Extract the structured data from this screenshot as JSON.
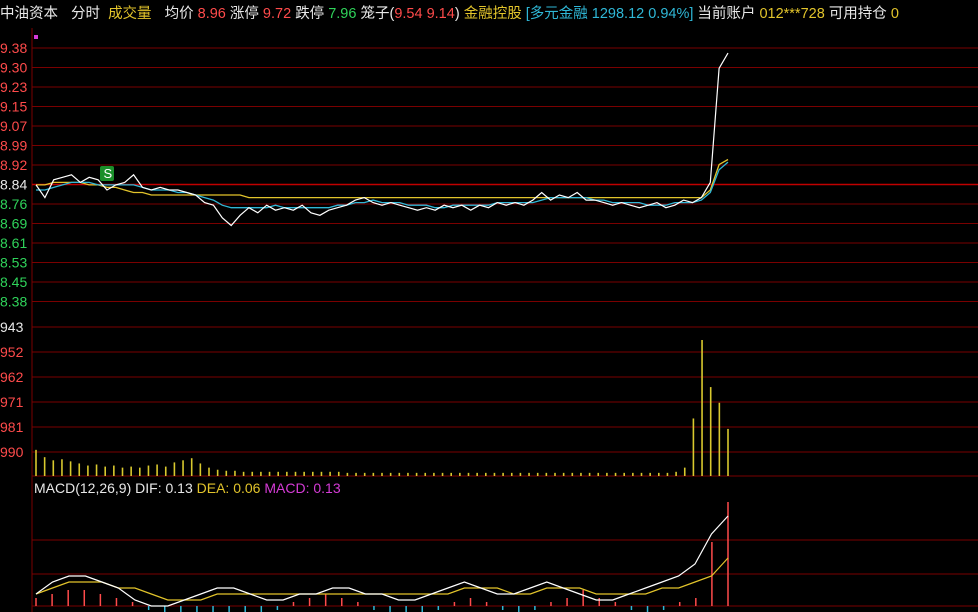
{
  "header": {
    "stock_name": "中油资本",
    "mode": "分时",
    "indicator": "成交量",
    "avg_label": "均价",
    "avg_value": "8.96",
    "limit_up_label": "涨停",
    "limit_up_value": "9.72",
    "limit_down_label": "跌停",
    "limit_down_value": "7.96",
    "cage_label": "笼子(",
    "cage_high": "9.54",
    "cage_low": "9.14",
    "cage_close": ")",
    "sector": "金融控股",
    "index_text": "[多元金融 1298.12 0.94%]",
    "account_label": "当前账户",
    "account_value": "012***728",
    "holding_label": "可用持仓",
    "holding_value": "0"
  },
  "price_axis": {
    "labels": [
      "9.38",
      "9.30",
      "9.23",
      "9.15",
      "9.07",
      "8.99",
      "8.92",
      "8.84",
      "8.76",
      "8.69",
      "8.61",
      "8.53",
      "8.45",
      "8.38"
    ],
    "prev_close": "8.84"
  },
  "volume_axis": {
    "labels": [
      "943",
      "952",
      "962",
      "971",
      "981",
      "990"
    ]
  },
  "trade_marker": "S",
  "macd": {
    "title": "MACD(12,26,9)",
    "dif_label": "DIF: 0.13",
    "dea_label": "DEA: 0.06",
    "macd_label": "MACD: 0.13"
  },
  "colors": {
    "price_line": "#ffffff",
    "avg_line": "#e2c42b",
    "ma_line": "#2fb7d6",
    "grid": "#7a0000",
    "up": "#ff4b4b",
    "down": "#2fd35a",
    "marker_bg": "#1a8f2a"
  },
  "chart_data": {
    "type": "line",
    "title": "",
    "ylim": [
      8.38,
      9.38
    ],
    "prev_close": 8.84,
    "price": [
      8.84,
      8.79,
      8.86,
      8.87,
      8.88,
      8.85,
      8.87,
      8.86,
      8.82,
      8.84,
      8.85,
      8.88,
      8.83,
      8.82,
      8.83,
      8.82,
      8.82,
      8.81,
      8.8,
      8.77,
      8.76,
      8.71,
      8.68,
      8.72,
      8.75,
      8.73,
      8.76,
      8.74,
      8.75,
      8.74,
      8.76,
      8.73,
      8.72,
      8.74,
      8.75,
      8.76,
      8.78,
      8.79,
      8.77,
      8.76,
      8.77,
      8.76,
      8.75,
      8.74,
      8.75,
      8.74,
      8.76,
      8.75,
      8.76,
      8.74,
      8.76,
      8.75,
      8.77,
      8.76,
      8.77,
      8.76,
      8.78,
      8.81,
      8.78,
      8.8,
      8.79,
      8.81,
      8.78,
      8.78,
      8.77,
      8.76,
      8.77,
      8.76,
      8.75,
      8.76,
      8.77,
      8.75,
      8.76,
      8.78,
      8.77,
      8.79,
      8.85,
      9.3,
      9.36
    ],
    "avg": [
      8.84,
      8.84,
      8.85,
      8.85,
      8.85,
      8.85,
      8.84,
      8.84,
      8.83,
      8.83,
      8.82,
      8.81,
      8.81,
      8.8,
      8.8,
      8.8,
      8.8,
      8.8,
      8.8,
      8.8,
      8.8,
      8.8,
      8.8,
      8.8,
      8.79,
      8.79,
      8.79,
      8.79,
      8.79,
      8.79,
      8.79,
      8.79,
      8.79,
      8.79,
      8.79,
      8.79,
      8.79,
      8.79,
      8.79,
      8.79,
      8.79,
      8.79,
      8.79,
      8.79,
      8.79,
      8.79,
      8.79,
      8.79,
      8.79,
      8.79,
      8.79,
      8.79,
      8.79,
      8.79,
      8.79,
      8.79,
      8.79,
      8.79,
      8.79,
      8.79,
      8.79,
      8.79,
      8.79,
      8.79,
      8.79,
      8.79,
      8.79,
      8.79,
      8.79,
      8.79,
      8.79,
      8.79,
      8.79,
      8.79,
      8.79,
      8.79,
      8.82,
      8.92,
      8.94
    ],
    "ma": [
      8.82,
      8.82,
      8.83,
      8.84,
      8.85,
      8.85,
      8.85,
      8.84,
      8.84,
      8.84,
      8.84,
      8.84,
      8.83,
      8.82,
      8.82,
      8.82,
      8.81,
      8.81,
      8.8,
      8.79,
      8.78,
      8.76,
      8.75,
      8.75,
      8.75,
      8.75,
      8.75,
      8.76,
      8.75,
      8.75,
      8.75,
      8.75,
      8.75,
      8.75,
      8.76,
      8.76,
      8.77,
      8.77,
      8.78,
      8.77,
      8.77,
      8.77,
      8.76,
      8.76,
      8.76,
      8.75,
      8.75,
      8.76,
      8.76,
      8.76,
      8.76,
      8.76,
      8.77,
      8.77,
      8.77,
      8.77,
      8.77,
      8.78,
      8.79,
      8.79,
      8.79,
      8.79,
      8.79,
      8.78,
      8.78,
      8.77,
      8.77,
      8.77,
      8.77,
      8.76,
      8.76,
      8.76,
      8.77,
      8.77,
      8.77,
      8.78,
      8.81,
      8.9,
      8.93
    ],
    "volume": [
      25,
      18,
      15,
      16,
      14,
      12,
      10,
      11,
      9,
      10,
      8,
      9,
      8,
      10,
      11,
      9,
      13,
      15,
      17,
      12,
      8,
      6,
      5,
      5,
      4,
      4,
      4,
      4,
      4,
      4,
      4,
      4,
      4,
      4,
      4,
      4,
      3,
      3,
      3,
      3,
      3,
      3,
      3,
      3,
      3,
      3,
      3,
      3,
      3,
      3,
      3,
      3,
      3,
      3,
      3,
      3,
      3,
      3,
      3,
      3,
      3,
      3,
      3,
      3,
      3,
      3,
      3,
      3,
      3,
      3,
      3,
      3,
      3,
      3,
      4,
      8,
      55,
      130,
      85,
      70,
      45
    ],
    "macd_hist": [
      0.01,
      0.015,
      0.02,
      0.02,
      0.015,
      0.01,
      0.005,
      -0.005,
      -0.01,
      -0.015,
      -0.02,
      -0.02,
      -0.015,
      -0.01,
      -0.01,
      -0.005,
      0.005,
      0.01,
      0.015,
      0.01,
      0.005,
      -0.005,
      -0.01,
      -0.015,
      -0.01,
      -0.005,
      0.005,
      0.01,
      0.005,
      -0.005,
      -0.01,
      -0.005,
      0.005,
      0.01,
      0.02,
      0.01,
      0.005,
      -0.005,
      -0.01,
      -0.005,
      0.005,
      0.01,
      0.08,
      0.13
    ],
    "dif": [
      0.0,
      0.02,
      0.03,
      0.03,
      0.02,
      0.01,
      -0.01,
      -0.02,
      -0.02,
      -0.01,
      0.0,
      0.01,
      0.01,
      0.0,
      -0.01,
      -0.01,
      0.0,
      0.0,
      0.01,
      0.01,
      0.0,
      0.0,
      -0.01,
      -0.01,
      0.0,
      0.01,
      0.02,
      0.01,
      0.0,
      0.0,
      0.01,
      0.02,
      0.01,
      0.0,
      -0.01,
      -0.01,
      0.0,
      0.01,
      0.02,
      0.03,
      0.05,
      0.1,
      0.13
    ],
    "dea": [
      0.0,
      0.01,
      0.02,
      0.02,
      0.02,
      0.01,
      0.01,
      0.0,
      -0.01,
      -0.01,
      -0.01,
      0.0,
      0.0,
      0.0,
      0.0,
      0.0,
      0.0,
      0.0,
      0.0,
      0.0,
      0.0,
      0.0,
      0.0,
      0.0,
      0.0,
      0.0,
      0.01,
      0.01,
      0.01,
      0.0,
      0.0,
      0.01,
      0.01,
      0.01,
      0.0,
      0.0,
      0.0,
      0.0,
      0.01,
      0.01,
      0.02,
      0.03,
      0.06
    ]
  }
}
